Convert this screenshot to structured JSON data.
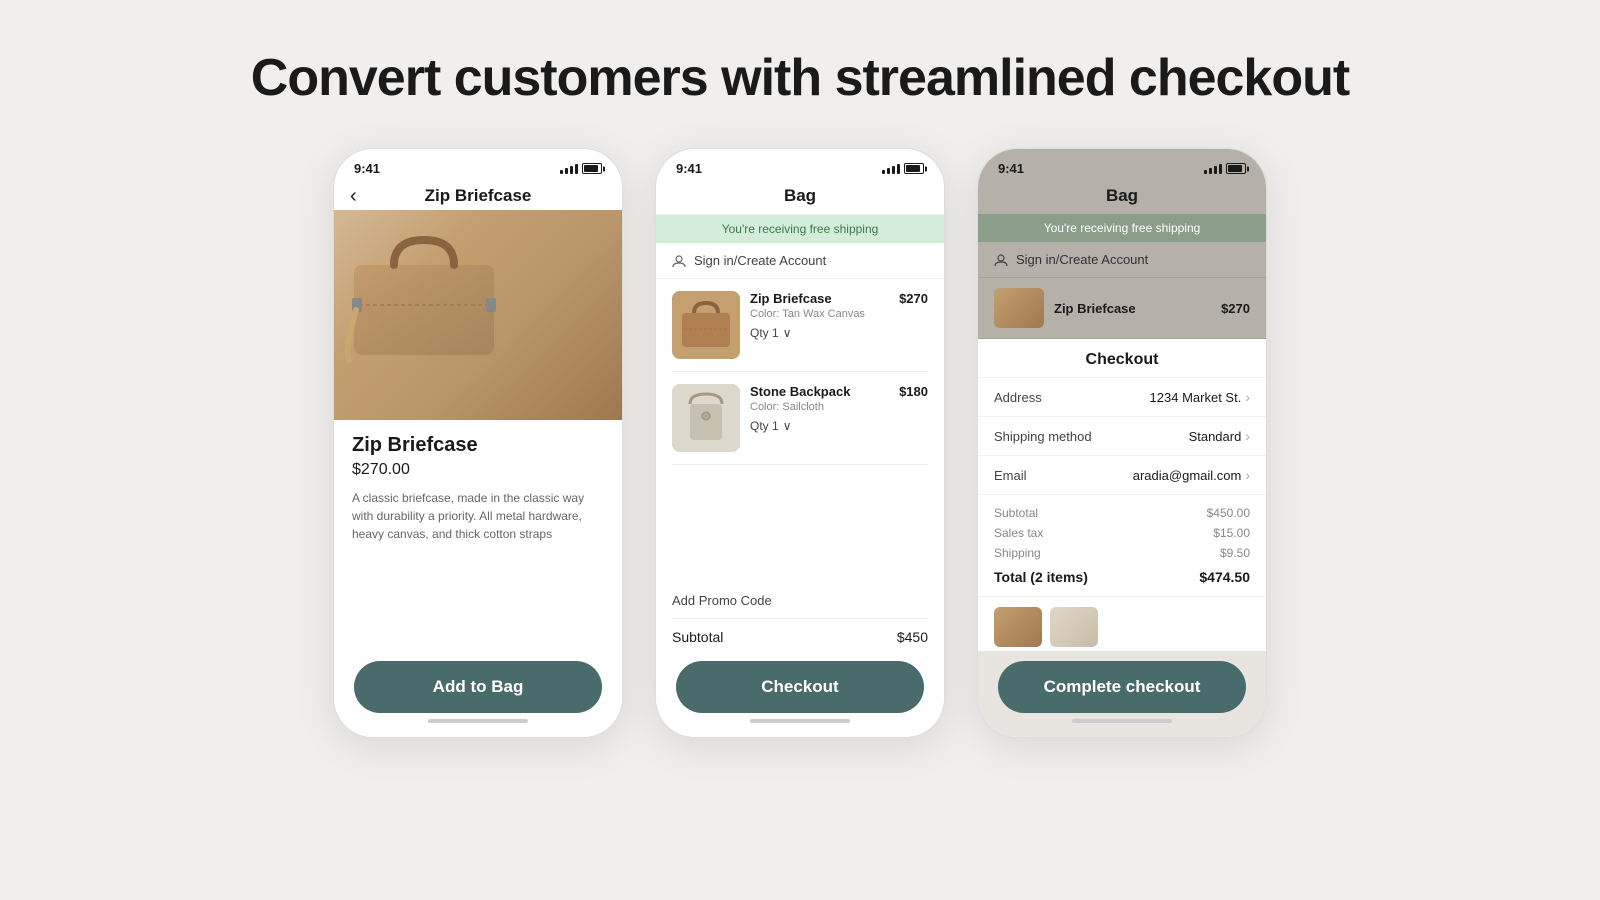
{
  "page": {
    "headline": "Convert customers with streamlined checkout"
  },
  "phone1": {
    "status_time": "9:41",
    "nav_title": "Zip Briefcase",
    "back_label": "‹",
    "product_name": "Zip Briefcase",
    "product_price": "$270.00",
    "product_description": "A classic briefcase, made in the classic way with durability a priority. All metal hardware, heavy canvas, and thick cotton straps",
    "cta_label": "Add to Bag"
  },
  "phone2": {
    "status_time": "9:41",
    "title": "Bag",
    "free_shipping_text": "You're receiving free shipping",
    "sign_in_text": "Sign in/Create Account",
    "items": [
      {
        "name": "Zip Briefcase",
        "color": "Color: Tan Wax Canvas",
        "price": "$270",
        "qty": "Qty 1"
      },
      {
        "name": "Stone Backpack",
        "color": "Color: Sailcloth",
        "price": "$180",
        "qty": "Qty 1"
      }
    ],
    "promo_code_label": "Add Promo Code",
    "subtotal_label": "Subtotal",
    "subtotal_value": "$450",
    "cta_label": "Checkout"
  },
  "phone3": {
    "status_time": "9:41",
    "bag_title": "Bag",
    "free_shipping_text": "You're receiving free shipping",
    "sign_in_text": "Sign in/Create Account",
    "mini_item_name": "Zip Briefcase",
    "mini_item_price": "$270",
    "checkout_title": "Checkout",
    "address_label": "Address",
    "address_value": "1234 Market St.",
    "shipping_label": "Shipping method",
    "shipping_value": "Standard",
    "email_label": "Email",
    "email_value": "aradia@gmail.com",
    "subtotal_label": "Subtotal",
    "subtotal_value": "$450.00",
    "sales_tax_label": "Sales tax",
    "sales_tax_value": "$15.00",
    "shipping_cost_label": "Shipping",
    "shipping_cost_value": "$9.50",
    "total_label": "Total (2 items)",
    "total_value": "$474.50",
    "cta_label": "Complete checkout"
  },
  "icons": {
    "back_arrow": "‹",
    "chevron_right": "›",
    "dropdown_arrow": "⌄",
    "user_icon": "○",
    "chevron_down": "∨"
  }
}
